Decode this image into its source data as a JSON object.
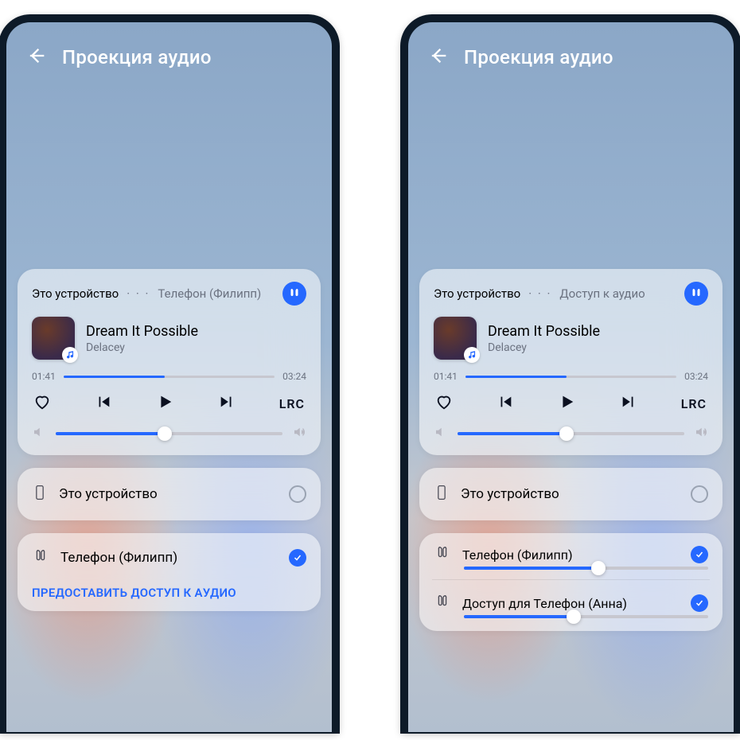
{
  "colors": {
    "accent": "#2568ff"
  },
  "header": {
    "title": "Проекция аудио"
  },
  "player": {
    "crumb_left_a": "Это устройство",
    "crumb_left_b": "Телефон (Филипп)",
    "crumb_right_a": "Это устройство",
    "crumb_right_b": "Доступ к аудио",
    "dots": "· · ·",
    "song": "Dream It Possible",
    "artist": "Delacey",
    "elapsed": "01:41",
    "duration": "03:24",
    "progress_pct": 48,
    "volume_pct": 48,
    "lrc": "LRC"
  },
  "devices": {
    "this_device": "Это устройство",
    "phone_philipp": "Телефон (Филипп)",
    "share_link": "ПРЕДОСТАВИТЬ ДОСТУП К АУДИО",
    "phone_anna": "Доступ для Телефон (Анна)",
    "phil_vol_pct": 55,
    "anna_vol_pct": 45
  }
}
